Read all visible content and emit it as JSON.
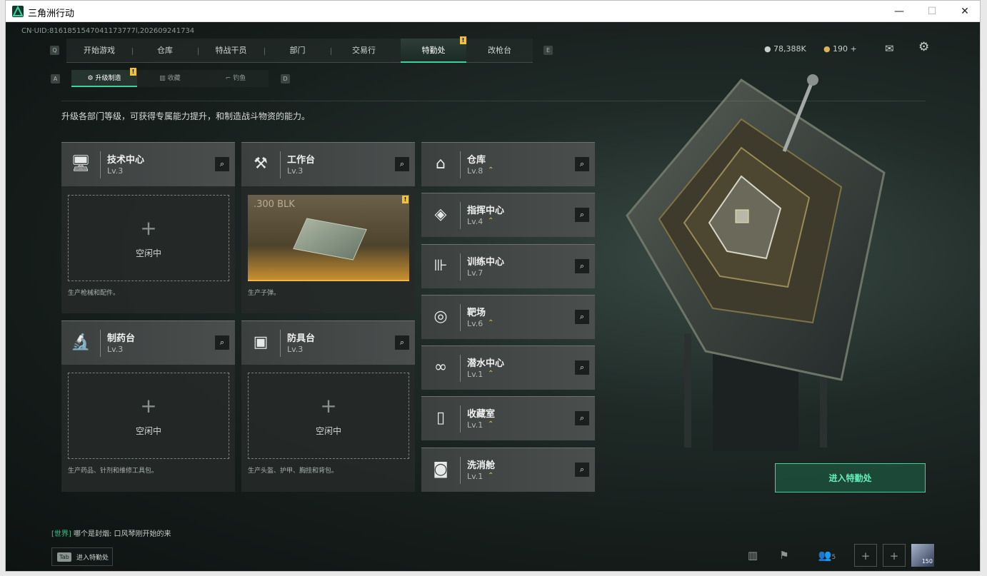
{
  "window": {
    "title": "三角洲行动",
    "minimize": "—",
    "maximize": "☐",
    "close": "✕"
  },
  "uid": "CN·UID:8161851547041173777l,202609241734",
  "tabs": {
    "left_key": "Q",
    "right_key": "E",
    "items": [
      {
        "label": "开始游戏"
      },
      {
        "label": "仓库"
      },
      {
        "label": "特战干员"
      },
      {
        "label": "部门"
      },
      {
        "label": "交易行"
      },
      {
        "label": "特勤处",
        "active": true,
        "warning": "!"
      },
      {
        "label": "改枪台"
      }
    ]
  },
  "subtabs": {
    "left_key": "A",
    "right_key": "D",
    "items": [
      {
        "label": "升级制造",
        "active": true,
        "warning": "!"
      },
      {
        "label": "收藏"
      },
      {
        "label": "钓鱼"
      }
    ]
  },
  "currency": {
    "coins": "78,388K",
    "tokens": "190 +"
  },
  "description": "升级各部门等级，可获得专属能力提升，和制造战斗物资的能力。",
  "left_departments": [
    {
      "name": "技术中心",
      "level": "Lv.3",
      "status": "空闲中",
      "footer": "生产枪械和配件。",
      "icon": "computer-icon"
    },
    {
      "name": "工作台",
      "level": "Lv.3",
      "product": ".300 BLK",
      "footer": "生产子弹。",
      "warning": "!",
      "icon": "tools-icon"
    },
    {
      "name": "制药台",
      "level": "Lv.3",
      "status": "空闲中",
      "footer": "生产药品、针剂和维修工具包。",
      "icon": "microscope-icon"
    },
    {
      "name": "防具台",
      "level": "Lv.3",
      "status": "空闲中",
      "footer": "生产头盔、护甲、胸挂和背包。",
      "icon": "armor-boxes-icon"
    }
  ],
  "right_departments": [
    {
      "name": "仓库",
      "level": "Lv.8",
      "upgrade": "⌃",
      "icon": "warehouse-icon"
    },
    {
      "name": "指挥中心",
      "level": "Lv.4",
      "upgrade": "⌃",
      "icon": "command-icon"
    },
    {
      "name": "训练中心",
      "level": "Lv.7",
      "icon": "dumbbell-icon"
    },
    {
      "name": "靶场",
      "level": "Lv.6",
      "upgrade": "⌃",
      "icon": "target-icon"
    },
    {
      "name": "潜水中心",
      "level": "Lv.1",
      "upgrade": "⌃",
      "icon": "goggles-icon"
    },
    {
      "name": "收藏室",
      "level": "Lv.1",
      "upgrade": "⌃",
      "icon": "display-case-icon"
    },
    {
      "name": "洗消舱",
      "level": "Lv.1",
      "upgrade": "⌃",
      "icon": "decon-icon"
    }
  ],
  "enter_button": "进入特勤处",
  "chat": {
    "channel": "[世界]",
    "message": "哪个是封烟: 口风琴刚开始的来"
  },
  "tab_hint": {
    "key": "Tab",
    "label": "进入特勤处"
  },
  "squad_count": "5",
  "avatar_badge": "150",
  "colors": {
    "accent": "#3ad39a",
    "warning": "#f0c239",
    "upgrade": "#e9c35a"
  }
}
